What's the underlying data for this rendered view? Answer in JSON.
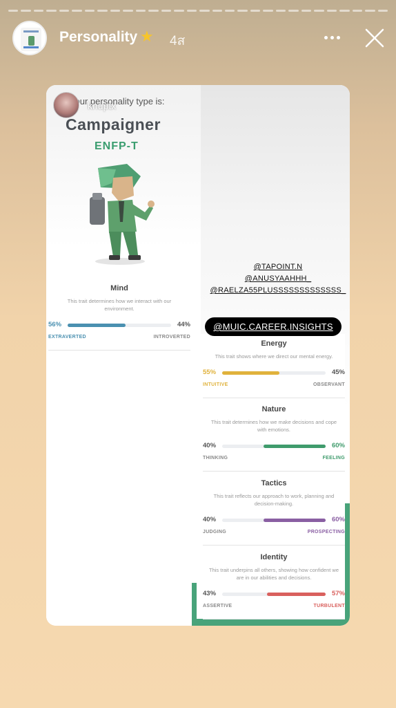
{
  "story": {
    "segments": 30,
    "title": "Personality",
    "title_emoji_icon": "star-icon",
    "time": "4ส"
  },
  "overlay": {
    "username": "knuptx",
    "mentions": [
      "@TAPOINT.N",
      "@ANUSYAAHHH_",
      "@RAELZA55PLUSSSSSSSSSSSSS_"
    ],
    "tag": "@MUIC.CAREER.INSIGHTS"
  },
  "result": {
    "label": "Your personality type is:",
    "type_name": "Campaigner",
    "type_code": "ENFP-T"
  },
  "traits": [
    {
      "name": "Mind",
      "description": "This trait determines how we interact with our environment.",
      "left_pct": "56%",
      "right_pct": "44%",
      "left_label": "EXTRAVERTED",
      "right_label": "INTROVERTED",
      "value": 56,
      "dominant": "left",
      "color": "#4a90b0"
    },
    {
      "name": "Energy",
      "description": "This trait shows where we direct our mental energy.",
      "left_pct": "55%",
      "right_pct": "45%",
      "left_label": "INTUITIVE",
      "right_label": "OBSERVANT",
      "value": 55,
      "dominant": "left",
      "color": "#e0b23c"
    },
    {
      "name": "Nature",
      "description": "This trait determines how we make decisions and cope with emotions.",
      "left_pct": "40%",
      "right_pct": "60%",
      "left_label": "THINKING",
      "right_label": "FEELING",
      "value": 60,
      "dominant": "right",
      "color": "#3f9b6c"
    },
    {
      "name": "Tactics",
      "description": "This trait reflects our approach to work, planning and decision-making.",
      "left_pct": "40%",
      "right_pct": "60%",
      "left_label": "JUDGING",
      "right_label": "PROSPECTING",
      "value": 60,
      "dominant": "right",
      "color": "#8a5fa3"
    },
    {
      "name": "Identity",
      "description": "This trait underpins all others, showing how confident we are in our abilities and decisions.",
      "left_pct": "43%",
      "right_pct": "57%",
      "left_label": "ASSERTIVE",
      "right_label": "TURBULENT",
      "value": 57,
      "dominant": "right",
      "color": "#d9605d"
    }
  ]
}
